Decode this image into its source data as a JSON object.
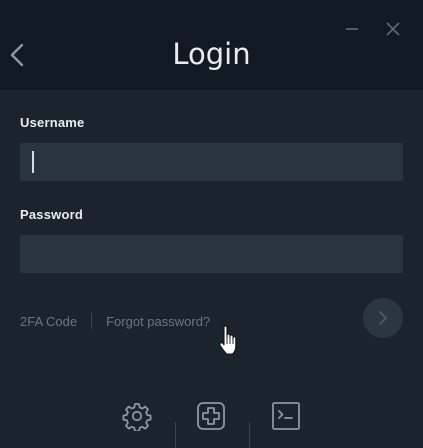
{
  "window": {
    "title": "Login"
  },
  "form": {
    "username_label": "Username",
    "username_value": "",
    "password_label": "Password",
    "password_value": ""
  },
  "links": {
    "twofa": "2FA Code",
    "forgot": "Forgot password?"
  },
  "icons": {
    "back": "chevron-left-icon",
    "minimize": "minimize-icon",
    "close": "close-icon",
    "submit": "chevron-right-icon",
    "settings": "gear-icon",
    "add": "plus-square-icon",
    "console": "terminal-icon"
  },
  "colors": {
    "header_bg": "#111923",
    "body_bg": "#1b232d",
    "field_bg": "#2a3440",
    "muted_text": "#6b7684"
  }
}
